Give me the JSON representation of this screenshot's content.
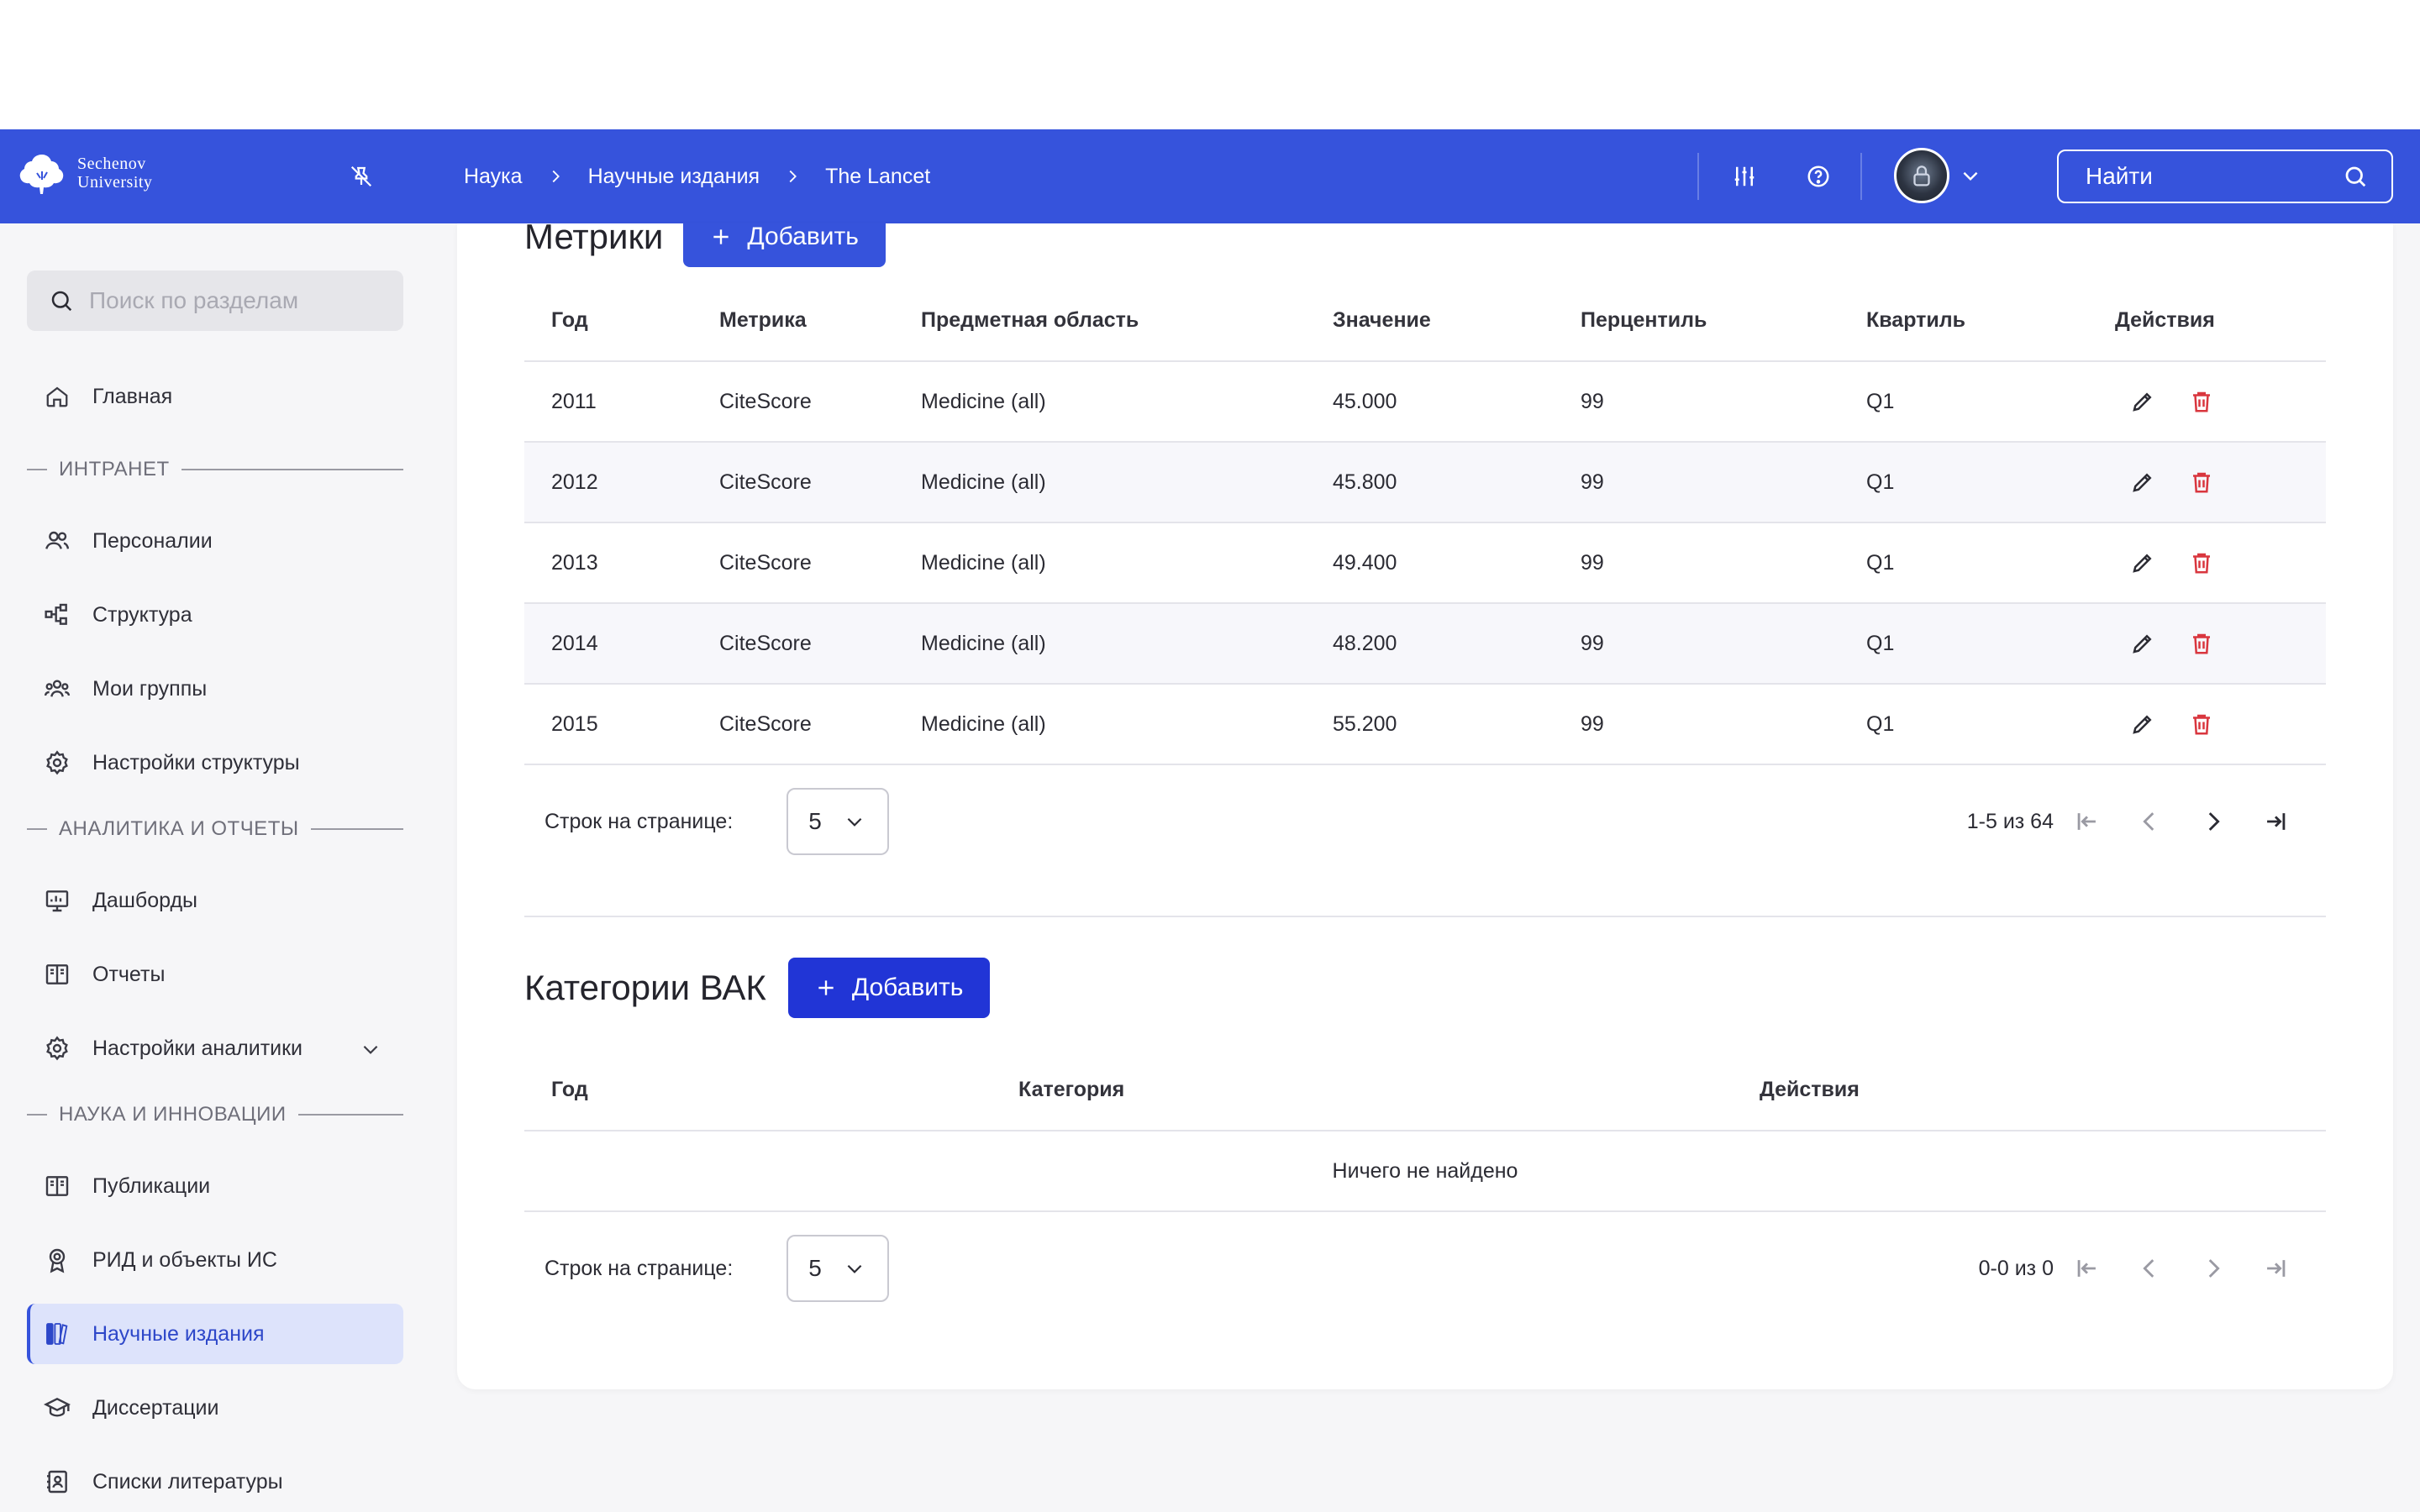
{
  "header": {
    "logo_line1": "Sechenov",
    "logo_line2": "University",
    "breadcrumbs": [
      "Наука",
      "Научные издания",
      "The Lancet"
    ],
    "search_label": "Найти"
  },
  "sidebar": {
    "search_placeholder": "Поиск по разделам",
    "home": "Главная",
    "section_intranet": "ИНТРАНЕТ",
    "personalii": "Персоналии",
    "structure": "Структура",
    "my_groups": "Мои группы",
    "structure_settings": "Настройки структуры",
    "section_analytics": "АНАЛИТИКА И ОТЧЕТЫ",
    "dashboards": "Дашборды",
    "reports": "Отчеты",
    "analytics_settings": "Настройки аналитики",
    "section_science": "НАУКА И ИННОВАЦИИ",
    "publications": "Публикации",
    "rid": "РИД и объекты ИС",
    "journals": "Научные издания",
    "dissertations": "Диссертации",
    "bibliography": "Списки литературы"
  },
  "metrics": {
    "title": "Метрики",
    "add_label": "Добавить",
    "columns": [
      "Год",
      "Метрика",
      "Предметная область",
      "Значение",
      "Перцентиль",
      "Квартиль",
      "Действия"
    ],
    "rows": [
      [
        "2011",
        "CiteScore",
        "Medicine (all)",
        "45.000",
        "99",
        "Q1"
      ],
      [
        "2012",
        "CiteScore",
        "Medicine (all)",
        "45.800",
        "99",
        "Q1"
      ],
      [
        "2013",
        "CiteScore",
        "Medicine (all)",
        "49.400",
        "99",
        "Q1"
      ],
      [
        "2014",
        "CiteScore",
        "Medicine (all)",
        "48.200",
        "99",
        "Q1"
      ],
      [
        "2015",
        "CiteScore",
        "Medicine (all)",
        "55.200",
        "99",
        "Q1"
      ]
    ],
    "rows_per_page_label": "Строк на странице:",
    "rows_per_page": "5",
    "range": "1-5 из 64"
  },
  "vak": {
    "title": "Категории ВАК",
    "add_label": "Добавить",
    "columns": [
      "Год",
      "Категория",
      "Действия"
    ],
    "empty": "Ничего не найдено",
    "rows_per_page_label": "Строк на странице:",
    "rows_per_page": "5",
    "range": "0-0 из 0"
  },
  "colors": {
    "brand": "#3653dc",
    "danger": "#d9363e",
    "active_bg": "#dde3fb"
  }
}
